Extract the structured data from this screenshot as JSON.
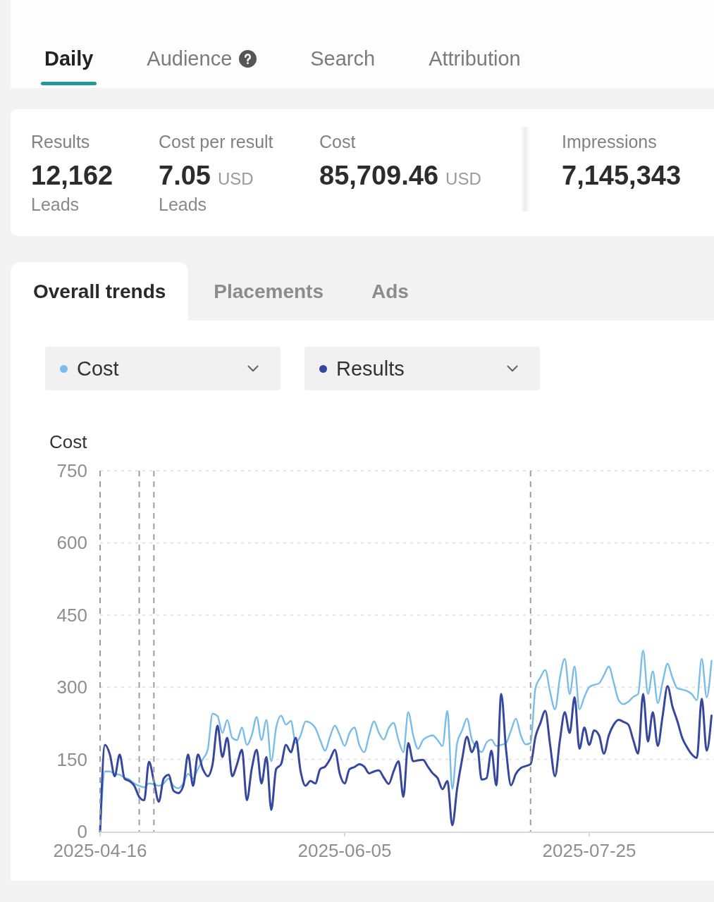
{
  "tabs": [
    {
      "label": "Daily",
      "selected": true,
      "help": false
    },
    {
      "label": "Audience",
      "selected": false,
      "help": true
    },
    {
      "label": "Search",
      "selected": false,
      "help": false
    },
    {
      "label": "Attribution",
      "selected": false,
      "help": false
    }
  ],
  "metrics": [
    {
      "label": "Results",
      "value": "12,162",
      "sublabel": "Leads"
    },
    {
      "label": "Cost per result",
      "value": "7.05",
      "unit": "USD",
      "sublabel": "Leads"
    },
    {
      "label": "Cost",
      "value": "85,709.46",
      "unit": "USD"
    },
    {
      "label": "Impressions",
      "value": "7,145,343"
    }
  ],
  "view_tabs": [
    {
      "label": "Overall trends",
      "selected": true
    },
    {
      "label": "Placements",
      "selected": false
    },
    {
      "label": "Ads",
      "selected": false
    }
  ],
  "metric_selectors": [
    {
      "label": "Cost",
      "color": "#78bce8"
    },
    {
      "label": "Results",
      "color": "#36479e"
    }
  ],
  "chart": {
    "chart_data": {
      "type": "line",
      "ylabel": "Cost",
      "categories": [
        "2025-04-16",
        null,
        null,
        null,
        null,
        null,
        null,
        null,
        null,
        null,
        null,
        null,
        null,
        null,
        null,
        null,
        null,
        null,
        null,
        null,
        null,
        null,
        null,
        null,
        null,
        null,
        null,
        null,
        null,
        null,
        null,
        null,
        null,
        null,
        null,
        null,
        null,
        null,
        null,
        null,
        null,
        null,
        null,
        null,
        null,
        null,
        null,
        null,
        null,
        null,
        "2025-06-05",
        null,
        null,
        null,
        null,
        null,
        null,
        null,
        null,
        null,
        null,
        null,
        null,
        null,
        null,
        null,
        null,
        null,
        null,
        null,
        null,
        null,
        null,
        null,
        null,
        null,
        null,
        null,
        null,
        null,
        null,
        null,
        null,
        null,
        null,
        null,
        null,
        null,
        null,
        null,
        null,
        null,
        null,
        null,
        null,
        null,
        null,
        null,
        null,
        null,
        "2025-07-25",
        null,
        null,
        null,
        null,
        null,
        null,
        null,
        null,
        null,
        null,
        null,
        null,
        null,
        null,
        null,
        null,
        null,
        null,
        null,
        null,
        null,
        null,
        null,
        null,
        null
      ],
      "series": [
        {
          "color": "#78bce8",
          "values": [
            0,
            125,
            125,
            120,
            118,
            112,
            108,
            100,
            95,
            92,
            100,
            98,
            95,
            100,
            110,
            95,
            90,
            100,
            120,
            110,
            130,
            150,
            170,
            245,
            240,
            205,
            232,
            195,
            190,
            216,
            180,
            200,
            238,
            190,
            232,
            146,
            216,
            241,
            222,
            230,
            184,
            200,
            229,
            226,
            215,
            190,
            168,
            197,
            220,
            200,
            178,
            205,
            216,
            180,
            165,
            200,
            229,
            205,
            191,
            215,
            226,
            190,
            165,
            248,
            200,
            172,
            190,
            197,
            200,
            190,
            178,
            251,
            88,
            184,
            210,
            235,
            191,
            175,
            165,
            185,
            191,
            178,
            180,
            184,
            210,
            235,
            200,
            181,
            184,
            298,
            320,
            336,
            290,
            254,
            320,
            359,
            286,
            343,
            254,
            280,
            300,
            305,
            308,
            325,
            343,
            310,
            273,
            265,
            270,
            280,
            286,
            376,
            286,
            333,
            267,
            310,
            349,
            320,
            298,
            295,
            292,
            285,
            273,
            359,
            279,
            355
          ]
        },
        {
          "color": "#36479e",
          "values": [
            0,
            180,
            160,
            115,
            160,
            110,
            105,
            95,
            72,
            65,
            145,
            105,
            62,
            110,
            118,
            85,
            80,
            95,
            160,
            95,
            160,
            130,
            115,
            140,
            220,
            155,
            195,
            115,
            140,
            170,
            65,
            130,
            170,
            100,
            155,
            45,
            130,
            140,
            180,
            165,
            195,
            125,
            95,
            105,
            100,
            130,
            135,
            150,
            170,
            120,
            100,
            130,
            134,
            140,
            135,
            121,
            125,
            127,
            112,
            99,
            125,
            146,
            72,
            184,
            146,
            148,
            149,
            135,
            121,
            111,
            88,
            105,
            13,
            90,
            150,
            197,
            165,
            187,
            108,
            111,
            168,
            96,
            286,
            170,
            96,
            120,
            132,
            136,
            140,
            197,
            225,
            251,
            180,
            115,
            190,
            248,
            205,
            279,
            172,
            216,
            180,
            210,
            200,
            162,
            200,
            222,
            232,
            228,
            222,
            190,
            162,
            286,
            187,
            248,
            178,
            240,
            302,
            260,
            230,
            195,
            175,
            160,
            153,
            276,
            168,
            241
          ]
        }
      ],
      "ylim": [
        0,
        750
      ],
      "yticks": [
        0,
        150,
        300,
        450,
        600,
        750
      ],
      "grid": true
    }
  }
}
